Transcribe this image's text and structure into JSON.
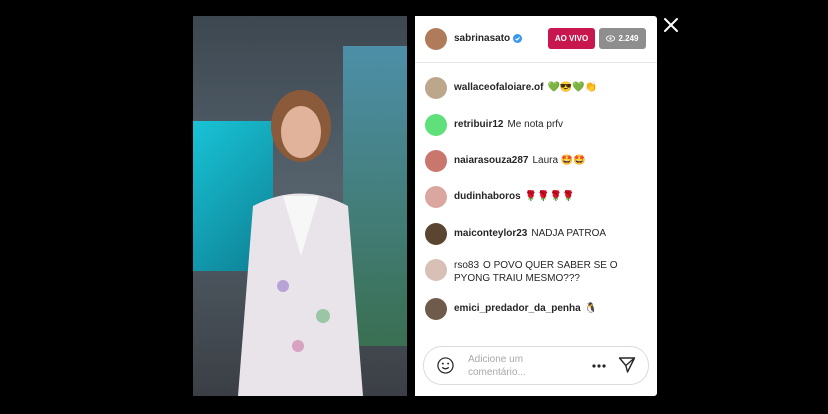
{
  "header": {
    "username": "sabrinasato",
    "live_label": "AO VIVO",
    "viewer_count": "2.249"
  },
  "comments": [
    {
      "username": "wallaceofaloiare.of",
      "text": "💚😎💚👏"
    },
    {
      "username": "retribuir12",
      "text": "Me nota prfv"
    },
    {
      "username": "naiarasouza287",
      "text": "Laura 🤩🤩"
    },
    {
      "username": "dudinhaboros",
      "text": "🌹🌹🌹🌹"
    },
    {
      "username": "maiconteylor23",
      "text": "NADJA PATROA"
    },
    {
      "username": "rso83",
      "text": "O POVO QUER SABER SE O PYONG TRAIU MESMO???"
    },
    {
      "username": "emici_predador_da_penha",
      "text": "🐧"
    }
  ],
  "composer": {
    "placeholder": "Adicione um comentário..."
  },
  "colors": {
    "live": "#c8174f",
    "viewer_badge": "#8e8e8e"
  },
  "icons": [
    "verified-badge-icon",
    "eye-icon",
    "emoji-icon",
    "more-options-icon",
    "send-icon",
    "close-icon"
  ]
}
